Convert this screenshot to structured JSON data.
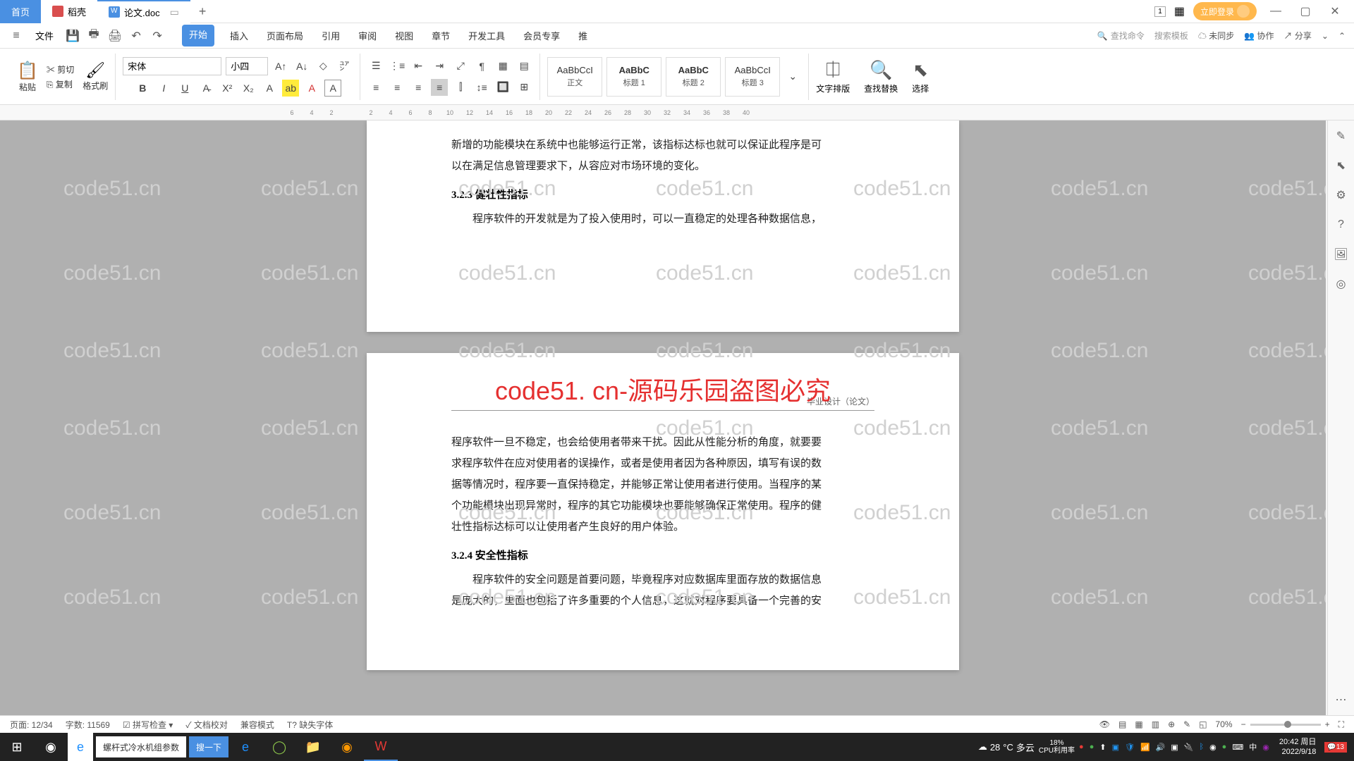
{
  "titlebar": {
    "home_tab": "首页",
    "docer_tab": "稻壳",
    "doc_tab": "论文.doc",
    "login": "立即登录"
  },
  "menubar": {
    "file": "文件",
    "tabs": [
      "开始",
      "插入",
      "页面布局",
      "引用",
      "审阅",
      "视图",
      "章节",
      "开发工具",
      "会员专享",
      "推"
    ],
    "search_cmd": "查找命令",
    "search_tpl": "搜索模板",
    "unsync": "未同步",
    "collab": "协作",
    "share": "分享"
  },
  "ribbon": {
    "paste": "粘贴",
    "cut": "剪切",
    "copy": "复制",
    "format_painter": "格式刷",
    "font": "宋体",
    "size": "小四",
    "styles": [
      {
        "preview": "AaBbCcI",
        "name": "正文"
      },
      {
        "preview": "AaBbC",
        "name": "标题 1"
      },
      {
        "preview": "AaBbC",
        "name": "标题 2"
      },
      {
        "preview": "AaBbCcI",
        "name": "标题 3"
      }
    ],
    "text_layout": "文字排版",
    "find_replace": "查找替换",
    "select": "选择"
  },
  "ruler_marks": [
    "6",
    "4",
    "2",
    "",
    "2",
    "4",
    "6",
    "8",
    "10",
    "12",
    "14",
    "16",
    "18",
    "20",
    "22",
    "24",
    "26",
    "28",
    "30",
    "32",
    "34",
    "36",
    "38",
    "40"
  ],
  "document": {
    "p1_line1": "新增的功能模块在系统中也能够运行正常，该指标达标也就可以保证此程序是可",
    "p1_line2": "以在满足信息管理要求下，从容应对市场环境的变化。",
    "h323": "3.2.3  健壮性指标",
    "p2": "程序软件的开发就是为了投入使用时，可以一直稳定的处理各种数据信息，",
    "page_header": "毕业设计（论文）",
    "p3_l1": "程序软件一旦不稳定，也会给使用者带来干扰。因此从性能分析的角度，就要要",
    "p3_l2": "求程序软件在应对使用者的误操作，或者是使用者因为各种原因，填写有误的数",
    "p3_l3": "据等情况时，程序要一直保持稳定，并能够正常让使用者进行使用。当程序的某",
    "p3_l4": "个功能模块出现异常时，程序的其它功能模块也要能够确保正常使用。程序的健",
    "p3_l5": "壮性指标达标可以让使用者产生良好的用户体验。",
    "h324": "3.2.4  安全性指标",
    "p4_l1": "程序软件的安全问题是首要问题，毕竟程序对应数据库里面存放的数据信息",
    "p4_l2": "是庞大的，里面也包括了许多重要的个人信息，这就对程序要具备一个完善的安",
    "watermark_red": "code51. cn-源码乐园盗图必究",
    "watermark_gray": "code51.cn"
  },
  "statusbar": {
    "page": "页面: 12/34",
    "words": "字数: 11569",
    "spell": "拼写检查",
    "proof": "文档校对",
    "compat": "兼容模式",
    "missing_font": "缺失字体",
    "zoom": "70%"
  },
  "taskbar": {
    "search_text": "螺杆式冷水机组参数",
    "search_btn": "搜一下",
    "weather_temp": "28",
    "weather_cond": "多云",
    "cpu": "CPU利用率",
    "cpu_pct": "18%",
    "ime": "中",
    "time": "20:42 周日",
    "date": "2022/9/18",
    "notif": "13"
  }
}
